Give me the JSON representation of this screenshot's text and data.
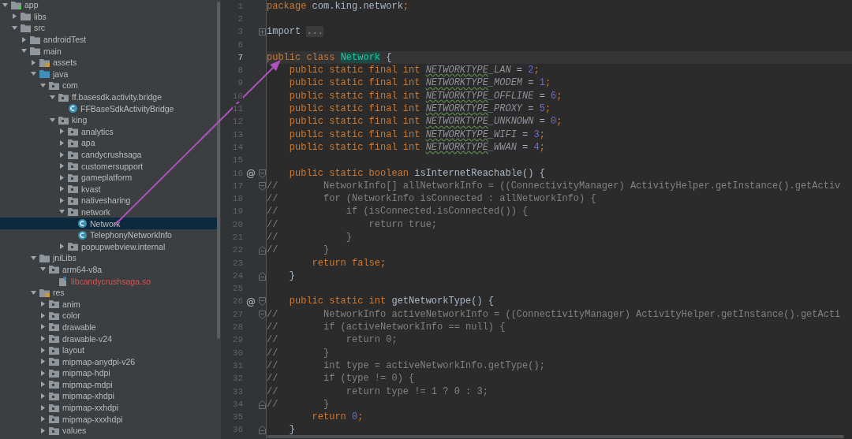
{
  "project_tree": {
    "items": [
      {
        "label": "app",
        "kind": "module",
        "expanded": true,
        "selected": false,
        "children": [
          {
            "label": "libs",
            "kind": "folder",
            "expanded": false,
            "selected": false
          },
          {
            "label": "src",
            "kind": "folder",
            "expanded": true,
            "selected": false,
            "children": [
              {
                "label": "androidTest",
                "kind": "folder",
                "expanded": false,
                "selected": false
              },
              {
                "label": "main",
                "kind": "folder",
                "expanded": true,
                "selected": false,
                "children": [
                  {
                    "label": "assets",
                    "kind": "resource-folder",
                    "expanded": false,
                    "selected": false
                  },
                  {
                    "label": "java",
                    "kind": "source-folder",
                    "expanded": true,
                    "selected": false,
                    "children": [
                      {
                        "label": "com",
                        "kind": "package",
                        "expanded": true,
                        "selected": false,
                        "children": [
                          {
                            "label": "ff.basesdk.activity.bridge",
                            "kind": "package",
                            "expanded": true,
                            "selected": false,
                            "children": [
                              {
                                "label": "FFBaseSdkActivityBridge",
                                "kind": "class",
                                "selected": false
                              }
                            ]
                          },
                          {
                            "label": "king",
                            "kind": "package",
                            "expanded": true,
                            "selected": false,
                            "children": [
                              {
                                "label": "analytics",
                                "kind": "package",
                                "expanded": false,
                                "selected": false
                              },
                              {
                                "label": "apa",
                                "kind": "package",
                                "expanded": false,
                                "selected": false
                              },
                              {
                                "label": "candycrushsaga",
                                "kind": "package",
                                "expanded": false,
                                "selected": false
                              },
                              {
                                "label": "customersupport",
                                "kind": "package",
                                "expanded": false,
                                "selected": false
                              },
                              {
                                "label": "gameplatform",
                                "kind": "package",
                                "expanded": false,
                                "selected": false
                              },
                              {
                                "label": "kvast",
                                "kind": "package",
                                "expanded": false,
                                "selected": false
                              },
                              {
                                "label": "nativesharing",
                                "kind": "package",
                                "expanded": false,
                                "selected": false
                              },
                              {
                                "label": "network",
                                "kind": "package",
                                "expanded": true,
                                "selected": false,
                                "children": [
                                  {
                                    "label": "Network",
                                    "kind": "class",
                                    "selected": true
                                  },
                                  {
                                    "label": "TelephonyNetworkInfo",
                                    "kind": "class",
                                    "selected": false
                                  }
                                ]
                              },
                              {
                                "label": "popupwebview.internal",
                                "kind": "package",
                                "expanded": false,
                                "selected": false
                              }
                            ]
                          }
                        ]
                      }
                    ]
                  },
                  {
                    "label": "jniLibs",
                    "kind": "folder",
                    "expanded": true,
                    "selected": false,
                    "children": [
                      {
                        "label": "arm64-v8a",
                        "kind": "package",
                        "expanded": true,
                        "selected": false,
                        "children": [
                          {
                            "label": "libcandycrushsaga.so",
                            "kind": "native-lib",
                            "selected": false
                          }
                        ]
                      }
                    ]
                  },
                  {
                    "label": "res",
                    "kind": "resource-folder",
                    "expanded": true,
                    "selected": false,
                    "children": [
                      {
                        "label": "anim",
                        "kind": "package",
                        "expanded": false,
                        "selected": false
                      },
                      {
                        "label": "color",
                        "kind": "package",
                        "expanded": false,
                        "selected": false
                      },
                      {
                        "label": "drawable",
                        "kind": "package",
                        "expanded": false,
                        "selected": false
                      },
                      {
                        "label": "drawable-v24",
                        "kind": "package",
                        "expanded": false,
                        "selected": false
                      },
                      {
                        "label": "layout",
                        "kind": "package",
                        "expanded": false,
                        "selected": false
                      },
                      {
                        "label": "mipmap-anydpi-v26",
                        "kind": "package",
                        "expanded": false,
                        "selected": false
                      },
                      {
                        "label": "mipmap-hdpi",
                        "kind": "package",
                        "expanded": false,
                        "selected": false
                      },
                      {
                        "label": "mipmap-mdpi",
                        "kind": "package",
                        "expanded": false,
                        "selected": false
                      },
                      {
                        "label": "mipmap-xhdpi",
                        "kind": "package",
                        "expanded": false,
                        "selected": false
                      },
                      {
                        "label": "mipmap-xxhdpi",
                        "kind": "package",
                        "expanded": false,
                        "selected": false
                      },
                      {
                        "label": "mipmap-xxxhdpi",
                        "kind": "package",
                        "expanded": false,
                        "selected": false
                      },
                      {
                        "label": "values",
                        "kind": "package",
                        "expanded": false,
                        "selected": false
                      }
                    ]
                  }
                ]
              }
            ]
          }
        ]
      }
    ]
  },
  "editor": {
    "lines": [
      {
        "number": "1",
        "current": false,
        "tokens": [
          {
            "kind": "keyword",
            "text": "package "
          },
          {
            "kind": "plain",
            "text": "com.king.network"
          },
          {
            "kind": "keyword",
            "text": ";"
          }
        ]
      },
      {
        "number": "2",
        "current": false
      },
      {
        "number": "3",
        "current": false,
        "collapsed": true,
        "tokens": [
          {
            "kind": "plain",
            "text": "import "
          },
          {
            "kind": "folded",
            "text": "..."
          }
        ]
      },
      {
        "number": "6",
        "current": false
      },
      {
        "number": "7",
        "current": true,
        "tokens": [
          {
            "kind": "keyword",
            "text": "public class "
          },
          {
            "kind": "class-name",
            "text": "Network"
          },
          {
            "kind": "plain",
            "text": " {"
          }
        ]
      },
      {
        "number": "8",
        "current": false,
        "tokens": [
          {
            "kind": "keyword",
            "text": "    public static final int "
          },
          {
            "kind": "constant-typo",
            "text": "NETWORKTYPE"
          },
          {
            "kind": "constant",
            "text": "_LAN"
          },
          {
            "kind": "plain",
            "text": " = "
          },
          {
            "kind": "number",
            "text": "2"
          },
          {
            "kind": "keyword",
            "text": ";"
          }
        ]
      },
      {
        "number": "9",
        "current": false,
        "tokens": [
          {
            "kind": "keyword",
            "text": "    public static final int "
          },
          {
            "kind": "constant-typo",
            "text": "NETWORKTYPE"
          },
          {
            "kind": "constant",
            "text": "_MODEM"
          },
          {
            "kind": "plain",
            "text": " = "
          },
          {
            "kind": "number",
            "text": "1"
          },
          {
            "kind": "keyword",
            "text": ";"
          }
        ]
      },
      {
        "number": "10",
        "current": false,
        "tokens": [
          {
            "kind": "keyword",
            "text": "    public static final int "
          },
          {
            "kind": "constant-typo",
            "text": "NETWORKTYPE"
          },
          {
            "kind": "constant",
            "text": "_OFFLINE"
          },
          {
            "kind": "plain",
            "text": " = "
          },
          {
            "kind": "number",
            "text": "6"
          },
          {
            "kind": "keyword",
            "text": ";"
          }
        ]
      },
      {
        "number": "11",
        "current": false,
        "tokens": [
          {
            "kind": "keyword",
            "text": "    public static final int "
          },
          {
            "kind": "constant-typo",
            "text": "NETWORKTYPE"
          },
          {
            "kind": "constant",
            "text": "_PROXY"
          },
          {
            "kind": "plain",
            "text": " = "
          },
          {
            "kind": "number",
            "text": "5"
          },
          {
            "kind": "keyword",
            "text": ";"
          }
        ]
      },
      {
        "number": "12",
        "current": false,
        "tokens": [
          {
            "kind": "keyword",
            "text": "    public static final int "
          },
          {
            "kind": "constant-typo",
            "text": "NETWORKTYPE"
          },
          {
            "kind": "constant",
            "text": "_UNKNOWN"
          },
          {
            "kind": "plain",
            "text": " = "
          },
          {
            "kind": "number",
            "text": "0"
          },
          {
            "kind": "keyword",
            "text": ";"
          }
        ]
      },
      {
        "number": "13",
        "current": false,
        "tokens": [
          {
            "kind": "keyword",
            "text": "    public static final int "
          },
          {
            "kind": "constant-typo",
            "text": "NETWORKTYPE"
          },
          {
            "kind": "constant",
            "text": "_WIFI"
          },
          {
            "kind": "plain",
            "text": " = "
          },
          {
            "kind": "number",
            "text": "3"
          },
          {
            "kind": "keyword",
            "text": ";"
          }
        ]
      },
      {
        "number": "14",
        "current": false,
        "tokens": [
          {
            "kind": "keyword",
            "text": "    public static final int "
          },
          {
            "kind": "constant-typo",
            "text": "NETWORKTYPE"
          },
          {
            "kind": "constant",
            "text": "_WWAN"
          },
          {
            "kind": "plain",
            "text": " = "
          },
          {
            "kind": "number",
            "text": "4"
          },
          {
            "kind": "keyword",
            "text": ";"
          }
        ]
      },
      {
        "number": "15",
        "current": false
      },
      {
        "number": "16",
        "current": false,
        "annotation": "@",
        "fold_start": true,
        "tokens": [
          {
            "kind": "keyword",
            "text": "    public static boolean "
          },
          {
            "kind": "plain",
            "text": "isInternetReachable() {"
          }
        ]
      },
      {
        "number": "17",
        "current": false,
        "fold_start": true,
        "tokens": [
          {
            "kind": "comment",
            "text": "//        NetworkInfo[] allNetworkInfo = ((ConnectivityManager) ActivityHelper.getInstance().getActiv"
          }
        ]
      },
      {
        "number": "18",
        "current": false,
        "tokens": [
          {
            "kind": "comment",
            "text": "//        for (NetworkInfo isConnected : allNetworkInfo) {"
          }
        ]
      },
      {
        "number": "19",
        "current": false,
        "tokens": [
          {
            "kind": "comment",
            "text": "//            if (isConnected.isConnected()) {"
          }
        ]
      },
      {
        "number": "20",
        "current": false,
        "tokens": [
          {
            "kind": "comment",
            "text": "//                return true;"
          }
        ]
      },
      {
        "number": "21",
        "current": false,
        "tokens": [
          {
            "kind": "comment",
            "text": "//            }"
          }
        ]
      },
      {
        "number": "22",
        "current": false,
        "fold_end": true,
        "tokens": [
          {
            "kind": "comment",
            "text": "//        }"
          }
        ]
      },
      {
        "number": "23",
        "current": false,
        "tokens": [
          {
            "kind": "keyword",
            "text": "        return false;"
          }
        ]
      },
      {
        "number": "24",
        "current": false,
        "fold_end": true,
        "tokens": [
          {
            "kind": "plain",
            "text": "    }"
          }
        ]
      },
      {
        "number": "25",
        "current": false
      },
      {
        "number": "26",
        "current": false,
        "annotation": "@",
        "fold_start": true,
        "tokens": [
          {
            "kind": "keyword",
            "text": "    public static int "
          },
          {
            "kind": "plain",
            "text": "getNetworkType() {"
          }
        ]
      },
      {
        "number": "27",
        "current": false,
        "fold_start": true,
        "tokens": [
          {
            "kind": "comment",
            "text": "//        NetworkInfo activeNetworkInfo = ((ConnectivityManager) ActivityHelper.getInstance().getActi"
          }
        ]
      },
      {
        "number": "28",
        "current": false,
        "tokens": [
          {
            "kind": "comment",
            "text": "//        if (activeNetworkInfo == null) {"
          }
        ]
      },
      {
        "number": "29",
        "current": false,
        "tokens": [
          {
            "kind": "comment",
            "text": "//            return 0;"
          }
        ]
      },
      {
        "number": "30",
        "current": false,
        "tokens": [
          {
            "kind": "comment",
            "text": "//        }"
          }
        ]
      },
      {
        "number": "31",
        "current": false,
        "tokens": [
          {
            "kind": "comment",
            "text": "//        int type = activeNetworkInfo.getType();"
          }
        ]
      },
      {
        "number": "32",
        "current": false,
        "tokens": [
          {
            "kind": "comment",
            "text": "//        if (type != 0) {"
          }
        ]
      },
      {
        "number": "33",
        "current": false,
        "tokens": [
          {
            "kind": "comment",
            "text": "//            return type != 1 ? 0 : 3;"
          }
        ]
      },
      {
        "number": "34",
        "current": false,
        "fold_end": true,
        "tokens": [
          {
            "kind": "comment",
            "text": "//        }"
          }
        ]
      },
      {
        "number": "35",
        "current": false,
        "tokens": [
          {
            "kind": "keyword",
            "text": "        return "
          },
          {
            "kind": "number",
            "text": "0"
          },
          {
            "kind": "keyword",
            "text": ";"
          }
        ]
      },
      {
        "number": "36",
        "current": false,
        "fold_end": true,
        "tokens": [
          {
            "kind": "plain",
            "text": "    }"
          }
        ]
      }
    ]
  }
}
